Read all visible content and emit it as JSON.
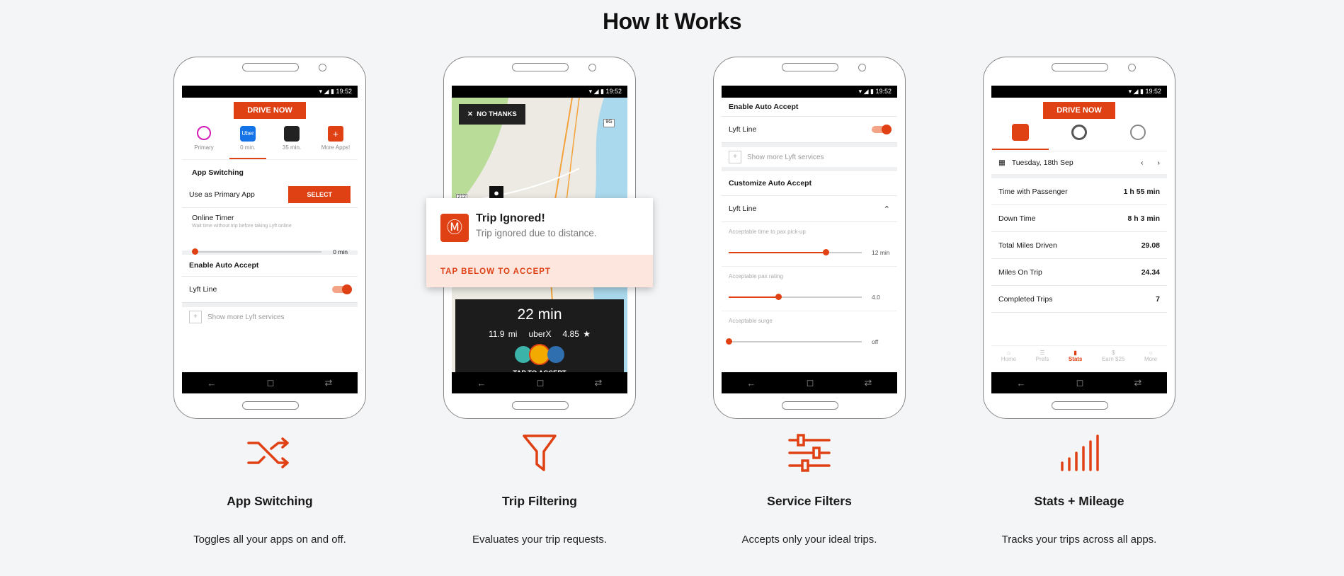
{
  "page": {
    "title": "How It Works"
  },
  "status_time": "19:52",
  "phone1": {
    "drive_label": "DRIVE NOW",
    "apps": [
      {
        "label": "Primary",
        "icon": "steering-wheel-icon"
      },
      {
        "label": "0 min.",
        "icon": "uber-icon",
        "text": "Uber"
      },
      {
        "label": "35 min.",
        "icon": "lyft-icon"
      },
      {
        "label": "More Apps!",
        "icon": "plus-icon",
        "text": "+"
      }
    ],
    "app_switching": "App Switching",
    "use_primary": "Use as Primary App",
    "select_label": "SELECT",
    "online_timer": "Online Timer",
    "online_timer_sub": "Wait time without trip before taking Lyft online",
    "timer_value": "0 min",
    "enable_auto": "Enable Auto Accept",
    "lyft_line": "Lyft Line",
    "show_more": "Show more",
    "show_more_suffix": "Lyft services"
  },
  "phone2": {
    "no_thanks": "NO THANKS",
    "notif_title": "Trip Ignored!",
    "notif_sub": "Trip ignored due to distance.",
    "tap_below": "TAP BELOW TO ACCEPT",
    "eta": "22 min",
    "distance": "11.9 mi",
    "service": "uberX",
    "rating": "4.85 ★",
    "tap_accept": "TAP TO ACCEPT",
    "map_marker_1": "212",
    "map_marker_2": "9G"
  },
  "phone3": {
    "enable_auto": "Enable Auto Accept",
    "lyft_line": "Lyft Line",
    "show_more": "Show more",
    "show_more_suffix": "Lyft services",
    "customize": "Customize Auto Accept",
    "lyft_line2": "Lyft Line",
    "pickup_label": "Acceptable time to pax pick-up",
    "pickup_value": "12 min",
    "rating_label": "Acceptable pax rating",
    "rating_value": "4.0",
    "surge_label": "Acceptable surge",
    "surge_value": "off",
    "levels": {
      "pickup": 0.73,
      "rating": 0.37,
      "surge": 0.0
    }
  },
  "phone4": {
    "drive_label": "DRIVE NOW",
    "date": "Tuesday, 18th Sep",
    "stats": [
      {
        "label": "Time with Passenger",
        "value": "1 h 55 min"
      },
      {
        "label": "Down Time",
        "value": "8 h 3 min"
      },
      {
        "label": "Total Miles Driven",
        "value": "29.08"
      },
      {
        "label": "Miles On Trip",
        "value": "24.34"
      },
      {
        "label": "Completed Trips",
        "value": "7"
      }
    ],
    "bottom_nav": [
      {
        "label": "Home",
        "icon": "home-icon"
      },
      {
        "label": "Prefs",
        "icon": "sliders-icon"
      },
      {
        "label": "Stats",
        "icon": "bar-chart-icon"
      },
      {
        "label": "Earn $25",
        "icon": "dollar-icon"
      },
      {
        "label": "More",
        "icon": "circle-icon"
      }
    ]
  },
  "features": [
    {
      "title": "App Switching",
      "desc": "Toggles all your apps on and off.",
      "icon": "shuffle-icon"
    },
    {
      "title": "Trip Filtering",
      "desc": "Evaluates your trip requests.",
      "icon": "funnel-icon"
    },
    {
      "title": "Service Filters",
      "desc": "Accepts only your ideal trips.",
      "icon": "sliders-icon"
    },
    {
      "title": "Stats + Mileage",
      "desc": "Tracks your trips across all apps.",
      "icon": "signal-bars-icon"
    }
  ],
  "colors": {
    "accent": "#e04114",
    "background": "#f4f5f7"
  }
}
